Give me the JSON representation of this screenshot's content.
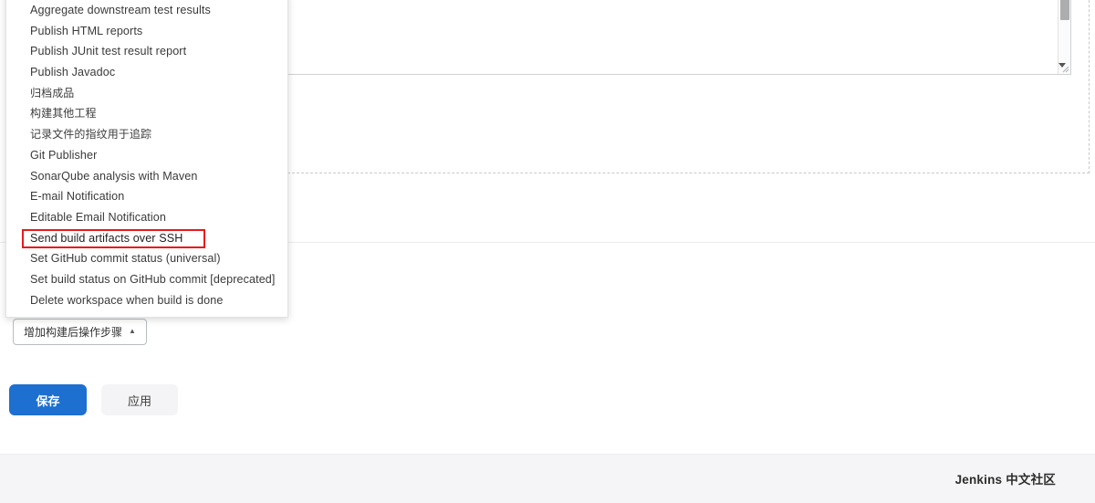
{
  "dropdown": {
    "name": "post-build-actions-menu",
    "items": [
      {
        "label": "Aggregate downstream test results",
        "cjk": false,
        "highlighted": false
      },
      {
        "label": "Publish HTML reports",
        "cjk": false,
        "highlighted": false
      },
      {
        "label": "Publish JUnit test result report",
        "cjk": false,
        "highlighted": false
      },
      {
        "label": "Publish Javadoc",
        "cjk": false,
        "highlighted": false
      },
      {
        "label": "归档成品",
        "cjk": true,
        "highlighted": false
      },
      {
        "label": "构建其他工程",
        "cjk": true,
        "highlighted": false
      },
      {
        "label": "记录文件的指纹用于追踪",
        "cjk": true,
        "highlighted": false
      },
      {
        "label": "Git Publisher",
        "cjk": false,
        "highlighted": false
      },
      {
        "label": "SonarQube analysis with Maven",
        "cjk": false,
        "highlighted": false
      },
      {
        "label": "E-mail Notification",
        "cjk": false,
        "highlighted": false
      },
      {
        "label": "Editable Email Notification",
        "cjk": false,
        "highlighted": false
      },
      {
        "label": "Send build artifacts over SSH",
        "cjk": false,
        "highlighted": true
      },
      {
        "label": "Set GitHub commit status (universal)",
        "cjk": false,
        "highlighted": false
      },
      {
        "label": "Set build status on GitHub commit [deprecated]",
        "cjk": false,
        "highlighted": false
      },
      {
        "label": "Delete workspace when build is done",
        "cjk": false,
        "highlighted": false
      }
    ],
    "highlight_color": "#e8191b"
  },
  "add_step_button": {
    "label": "增加构建后操作步骤",
    "caret": "▲"
  },
  "actions": {
    "save_label": "保存",
    "apply_label": "应用",
    "save_color": "#1d6fd0",
    "apply_color": "#f4f4f6"
  },
  "textarea": {
    "value": "",
    "scrollbar": "vertical-scrollbar",
    "resize_handle": "resize-grip"
  },
  "footer": {
    "brand": "Jenkins 中文社区",
    "background": "#f5f5f7"
  }
}
